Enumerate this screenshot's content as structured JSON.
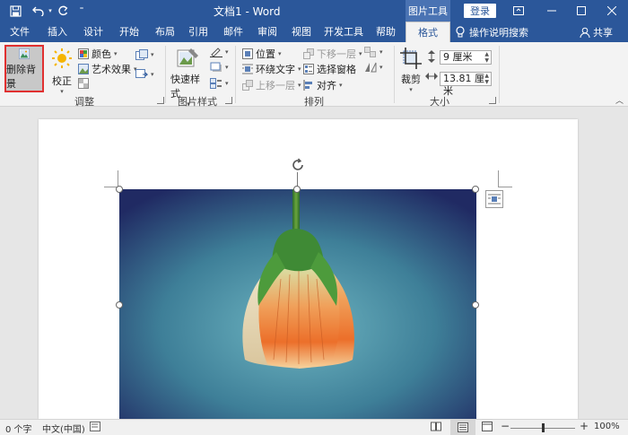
{
  "titlebar": {
    "doc_title": "文档1 - Word",
    "tools_header": "图片工具",
    "login": "登录"
  },
  "tabs": [
    {
      "label": "文件"
    },
    {
      "label": "插入"
    },
    {
      "label": "设计"
    },
    {
      "label": "开始"
    },
    {
      "label": "布局"
    },
    {
      "label": "引用"
    },
    {
      "label": "邮件"
    },
    {
      "label": "审阅"
    },
    {
      "label": "视图"
    },
    {
      "label": "开发工具"
    },
    {
      "label": "帮助"
    },
    {
      "label": "格式",
      "active": true
    }
  ],
  "tell_me": "操作说明搜索",
  "share": "共享",
  "ribbon": {
    "adjust": {
      "remove_background": "删除背景",
      "corrections": "校正",
      "color": "颜色",
      "artistic_effects": "艺术效果",
      "group_label": "调整"
    },
    "styles": {
      "quick_styles": "快速样式",
      "group_label": "图片样式"
    },
    "arrange": {
      "position": "位置",
      "wrap_text": "环绕文字",
      "bring_forward": "上移一层",
      "send_backward": "下移一层",
      "selection_pane": "选择窗格",
      "align": "对齐",
      "group_label": "排列"
    },
    "size": {
      "crop": "裁剪",
      "height": "9 厘米",
      "width": "13.81 厘米",
      "group_label": "大小"
    }
  },
  "statusbar": {
    "word_count": "0 个字",
    "language": "中文(中国)",
    "zoom": "100%",
    "zoom_minus": "−",
    "zoom_plus": "+",
    "zoom_level": 0.5
  },
  "colors": {
    "brand": "#2b579a",
    "highlight": "#e03030"
  }
}
